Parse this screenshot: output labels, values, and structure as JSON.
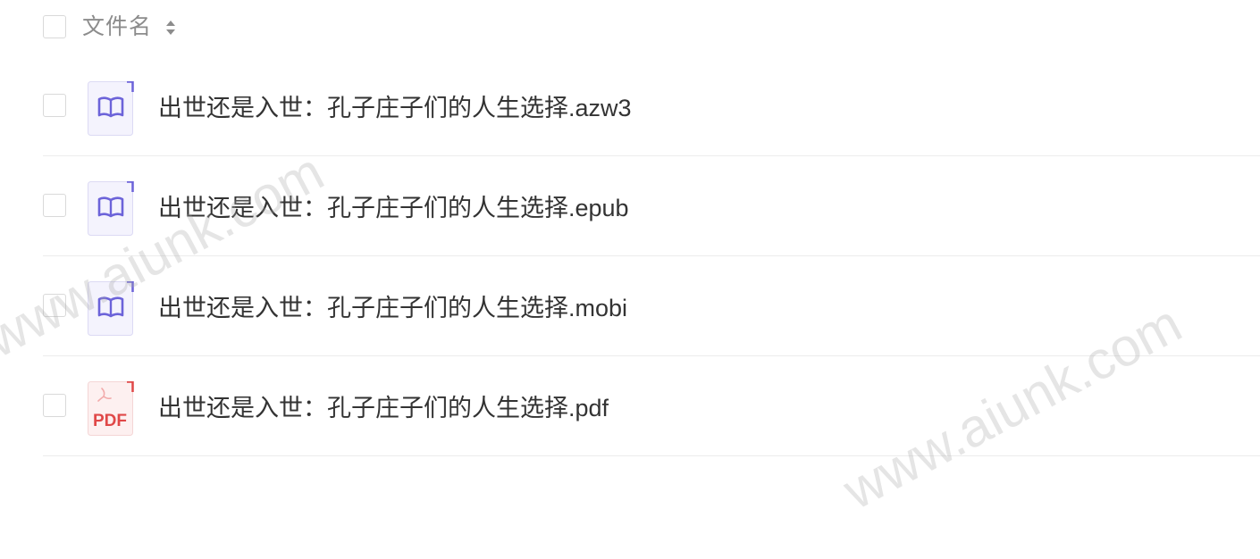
{
  "header": {
    "column_label": "文件名"
  },
  "files": [
    {
      "name": "出世还是入世：孔子庄子们的人生选择.azw3",
      "type": "ebook"
    },
    {
      "name": "出世还是入世：孔子庄子们的人生选择.epub",
      "type": "ebook"
    },
    {
      "name": "出世还是入世：孔子庄子们的人生选择.mobi",
      "type": "ebook"
    },
    {
      "name": "出世还是入世：孔子庄子们的人生选择.pdf",
      "type": "pdf"
    }
  ],
  "icons": {
    "ebook": "ebook-file-icon",
    "pdf": "pdf-file-icon",
    "pdf_label": "PDF"
  },
  "watermark": {
    "text": "www.aiunk.com"
  },
  "colors": {
    "ebook_accent": "#6c63d9",
    "pdf_accent": "#e04848",
    "text": "#333333",
    "header_text": "#8c8c8c"
  }
}
